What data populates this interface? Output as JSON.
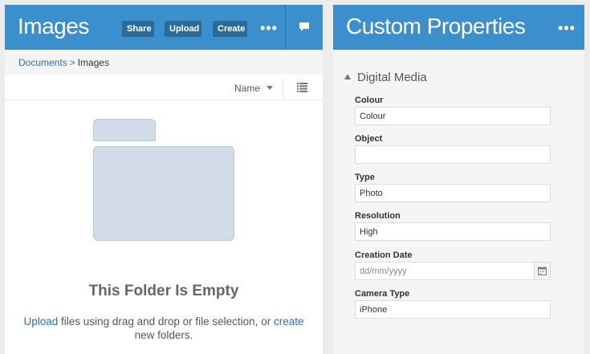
{
  "left_panel": {
    "title": "Images",
    "buttons": {
      "share": "Share",
      "upload": "Upload",
      "create": "Create"
    },
    "more": "•••",
    "breadcrumb": {
      "parent": "Documents",
      "separator": ">",
      "current": "Images"
    },
    "sort_label": "Name",
    "empty": {
      "title": "This Folder Is Empty",
      "upload_link": "Upload",
      "text_middle": " files using drag and drop or file selection, or ",
      "create_link": "create",
      "text_end": " new folders."
    }
  },
  "right_panel": {
    "title": "Custom Properties",
    "more": "•••",
    "section": "Digital Media",
    "fields": {
      "colour": {
        "label": "Colour",
        "value": "Colour"
      },
      "object": {
        "label": "Object",
        "value": ""
      },
      "type": {
        "label": "Type",
        "value": "Photo"
      },
      "resolution": {
        "label": "Resolution",
        "value": "High"
      },
      "creation_date": {
        "label": "Creation Date",
        "value": "",
        "placeholder": "dd/mm/yyyy"
      },
      "camera_type": {
        "label": "Camera Type",
        "value": "iPhone"
      }
    }
  },
  "colors": {
    "header": "#3b8fcc",
    "button": "#2a6b9a",
    "link": "#2f6fad",
    "folder": "#d1dce8"
  }
}
